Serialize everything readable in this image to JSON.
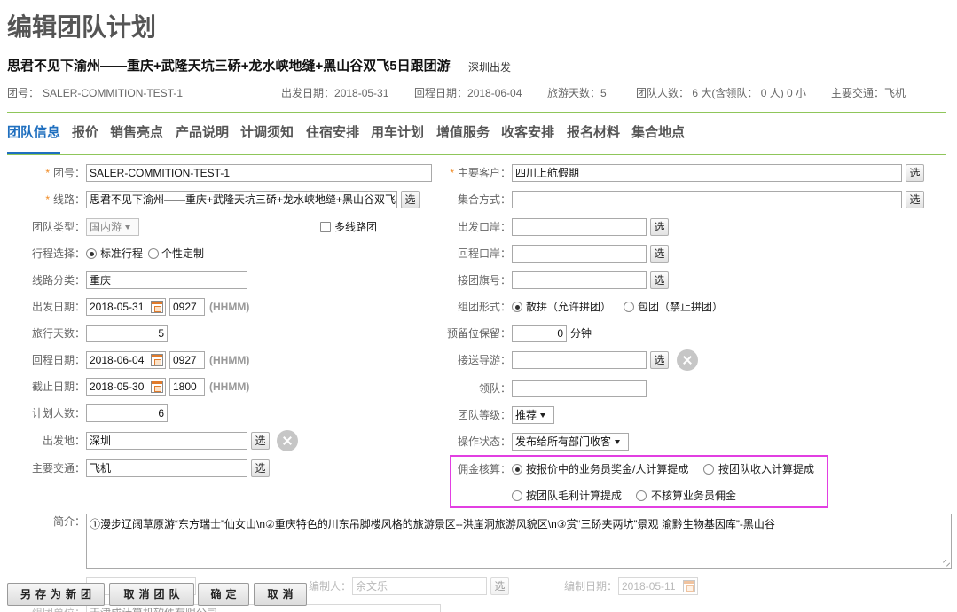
{
  "page": {
    "title": "编辑团队计划"
  },
  "colors": {
    "accent": "#1f6fbf",
    "divider": "#8fc65a",
    "highlight": "#e23fe2",
    "required": "#f08a24"
  },
  "icons": {
    "calendar": "calendar-icon",
    "clear": "clear-circle-icon",
    "dropdown": "dropdown-arrow-icon",
    "resize": "resize-grip-icon"
  },
  "summary": {
    "route_name": "思君不见下渝州——重庆+武隆天坑三硚+龙水峡地缝+黑山谷双飞5日跟团游",
    "departure_city": "深圳出发",
    "info": [
      {
        "label": "团号：",
        "value": "SALER-COMMITION-TEST-1"
      },
      {
        "label": "出发日期：",
        "value": "2018-05-31"
      },
      {
        "label": "回程日期：",
        "value": "2018-06-04"
      },
      {
        "label": "旅游天数：",
        "value": "5"
      },
      {
        "label": "团队人数：",
        "value": " 6 大(含领队： 0 人) 0 小"
      },
      {
        "label": "主要交通：",
        "value": "飞机"
      }
    ]
  },
  "tabs": {
    "active_index": 0,
    "items": [
      "团队信息",
      "报价",
      "销售亮点",
      "产品说明",
      "计调须知",
      "住宿安排",
      "用车计划",
      "增值服务",
      "收客安排",
      "报名材料",
      "集合地点"
    ]
  },
  "form": {
    "required_mark": "*",
    "pick_label": "选",
    "time_hint": "(HHMM)",
    "team_no": {
      "label": "团号：",
      "value": "SALER-COMMITION-TEST-1"
    },
    "route": {
      "label": "线路：",
      "value": "思君不见下渝州——重庆+武隆天坑三硚+龙水峡地缝+黑山谷双飞"
    },
    "team_type": {
      "label": "团队类型：",
      "value": "国内游"
    },
    "multi_route": {
      "label": "多线路团",
      "checked": false
    },
    "itinerary": {
      "label": "行程选择：",
      "options": [
        "标准行程",
        "个性定制"
      ],
      "selected_index": 0
    },
    "route_category": {
      "label": "线路分类：",
      "value": "重庆"
    },
    "departure_date": {
      "label": "出发日期：",
      "date": "2018-05-31",
      "time": "0927"
    },
    "travel_days": {
      "label": "旅行天数：",
      "value": "5"
    },
    "return_date": {
      "label": "回程日期：",
      "date": "2018-06-04",
      "time": "0927"
    },
    "deadline": {
      "label": "截止日期：",
      "date": "2018-05-30",
      "time": "1800"
    },
    "planned_count": {
      "label": "计划人数：",
      "value": "6"
    },
    "departure_place": {
      "label": "出发地：",
      "value": "深圳"
    },
    "main_transport": {
      "label": "主要交通：",
      "value": "飞机"
    },
    "main_customer": {
      "label": "主要客户：",
      "value": "四川上航假期"
    },
    "meeting_method": {
      "label": "集合方式：",
      "value": ""
    },
    "departure_port": {
      "label": "出发口岸：",
      "value": ""
    },
    "return_port": {
      "label": "回程口岸：",
      "value": ""
    },
    "group_flag": {
      "label": "接团旗号：",
      "value": ""
    },
    "group_form": {
      "label": "组团形式：",
      "options": [
        "散拼（允许拼团）",
        "包团（禁止拼团）"
      ],
      "selected_index": 0
    },
    "reserve_hold": {
      "label": "预留位保留：",
      "value": "0",
      "unit": "分钟"
    },
    "guide": {
      "label": "接送导游：",
      "value": ""
    },
    "leader": {
      "label": "领队：",
      "value": ""
    },
    "team_level": {
      "label": "团队等级：",
      "value": "推荐"
    },
    "op_status": {
      "label": "操作状态：",
      "value": "发布给所有部门收客"
    },
    "commission": {
      "label": "佣金核算：",
      "options": [
        "按报价中的业务员奖金/人计算提成",
        "按团队收入计算提成",
        "按团队毛利计算提成",
        "不核算业务员佣金"
      ],
      "selected_index": 0
    },
    "intro": {
      "label": "简介：",
      "value": "①漫步辽阔草原游“东方瑞士”仙女山\\n②重庆特色的川东吊脚楼风格的旅游景区--洪崖洞旅游风貌区\\n③赏“三硚夹两坑”景观 渝黔生物基因库”-黑山谷"
    },
    "editor": {
      "label": "编制人：",
      "value": "余文乐"
    },
    "edit_date": {
      "label": "编制日期：",
      "value": "2018-05-11"
    },
    "org_unit": {
      "label": "组团单位：",
      "value": "天津成计算机软件有限公司"
    }
  },
  "actions": {
    "save_as_new": "另存为新团",
    "cancel_team": "取消团队",
    "confirm": "确定",
    "cancel": "取消"
  }
}
